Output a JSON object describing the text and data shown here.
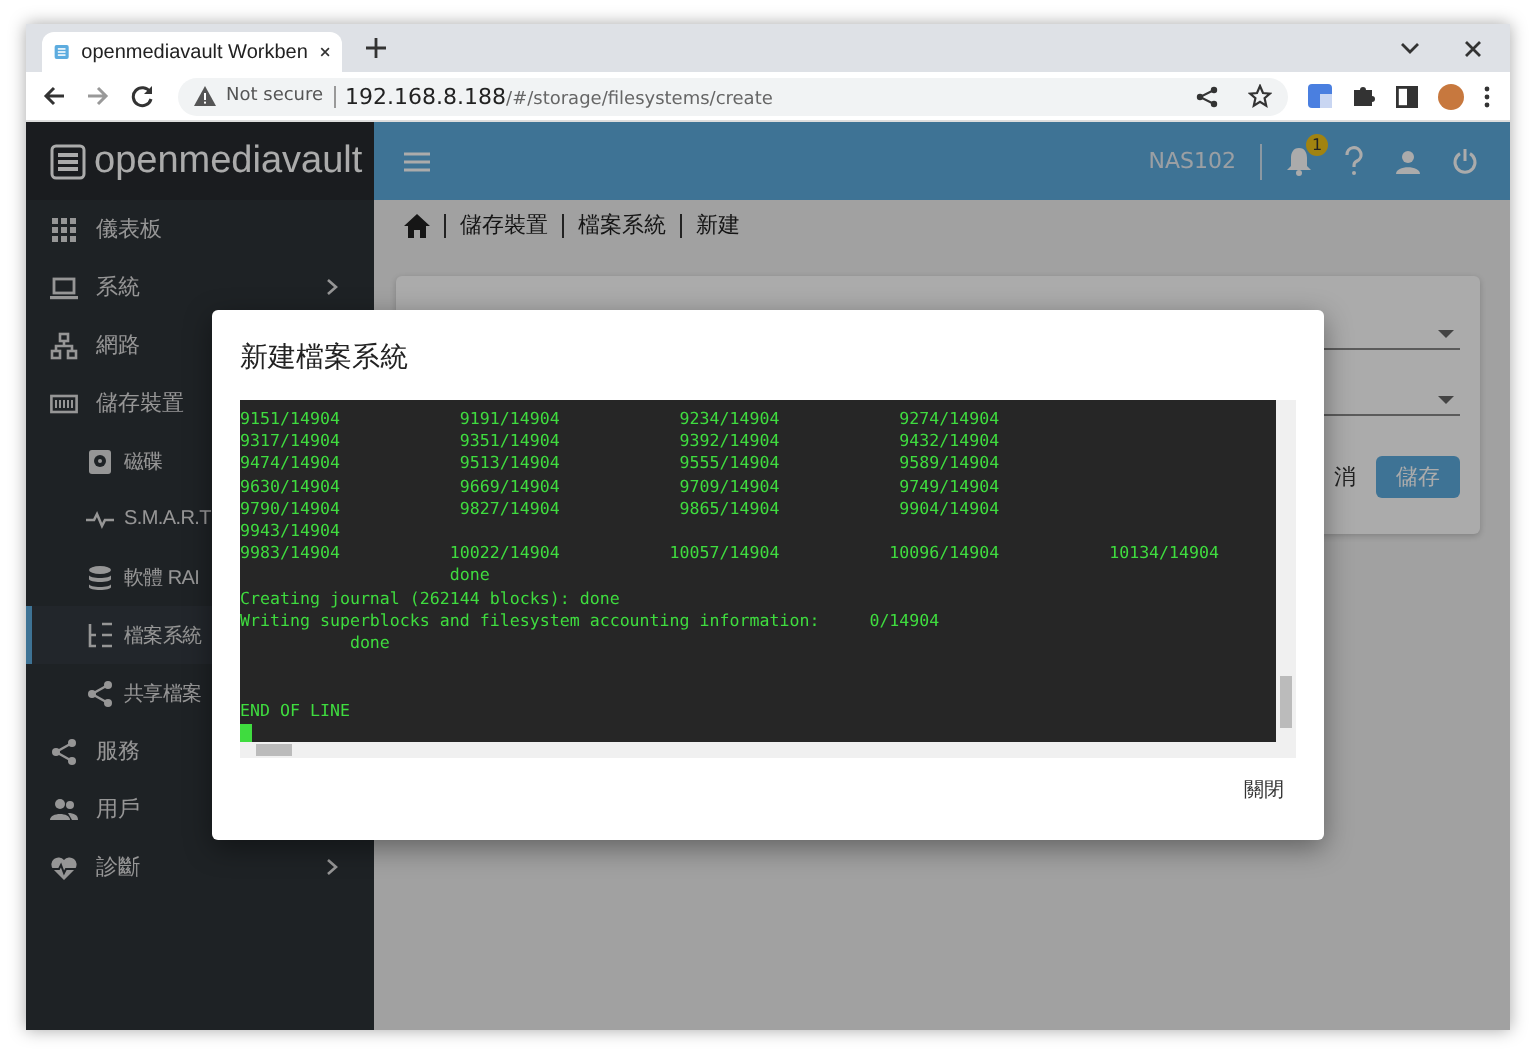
{
  "browser": {
    "tab_title": "openmediavault Workben",
    "security": "Not secure",
    "url_host": "192.168.8.188",
    "url_path": "/#/storage/filesystems/create"
  },
  "topbar": {
    "logo": "openmediavault",
    "hostname": "NAS102",
    "notification_count": "1"
  },
  "sidebar": {
    "items": [
      {
        "label": "儀表板",
        "selected": false,
        "has_submenu": false
      },
      {
        "label": "系統",
        "selected": false,
        "has_submenu": true
      },
      {
        "label": "網路",
        "selected": false
      },
      {
        "label": "儲存裝置",
        "selected": false,
        "children": [
          {
            "label": "磁碟",
            "selected": false
          },
          {
            "label": "S.M.A.R.T",
            "selected": false
          },
          {
            "label": "軟體 RAI",
            "selected": false
          },
          {
            "label": "檔案系統",
            "selected": true
          },
          {
            "label": "共享檔案",
            "selected": false
          }
        ]
      },
      {
        "label": "服務",
        "selected": false
      },
      {
        "label": "用戶",
        "selected": false
      },
      {
        "label": "診斷",
        "selected": false,
        "has_submenu": true
      }
    ]
  },
  "breadcrumb": [
    "儲存裝置",
    "檔案系統",
    "新建"
  ],
  "form": {
    "buttons": [
      {
        "label": "消",
        "kind": "cancel"
      },
      {
        "label": "儲存",
        "kind": "primary"
      }
    ]
  },
  "dialog": {
    "title": "新建檔案系統",
    "output": "9151/14904            9191/14904            9234/14904            9274/14904\n9317/14904            9351/14904            9392/14904            9432/14904\n9474/14904            9513/14904            9555/14904            9589/14904\n9630/14904            9669/14904            9709/14904            9749/14904\n9790/14904            9827/14904            9865/14904            9904/14904\n9943/14904\n9983/14904           10022/14904           10057/14904           10096/14904           10134/14904\n                     done\nCreating journal (262144 blocks): done\nWriting superblocks and filesystem accounting information:     0/14904\n           done\n\n\nEND OF LINE",
    "close_button": "關閉"
  }
}
